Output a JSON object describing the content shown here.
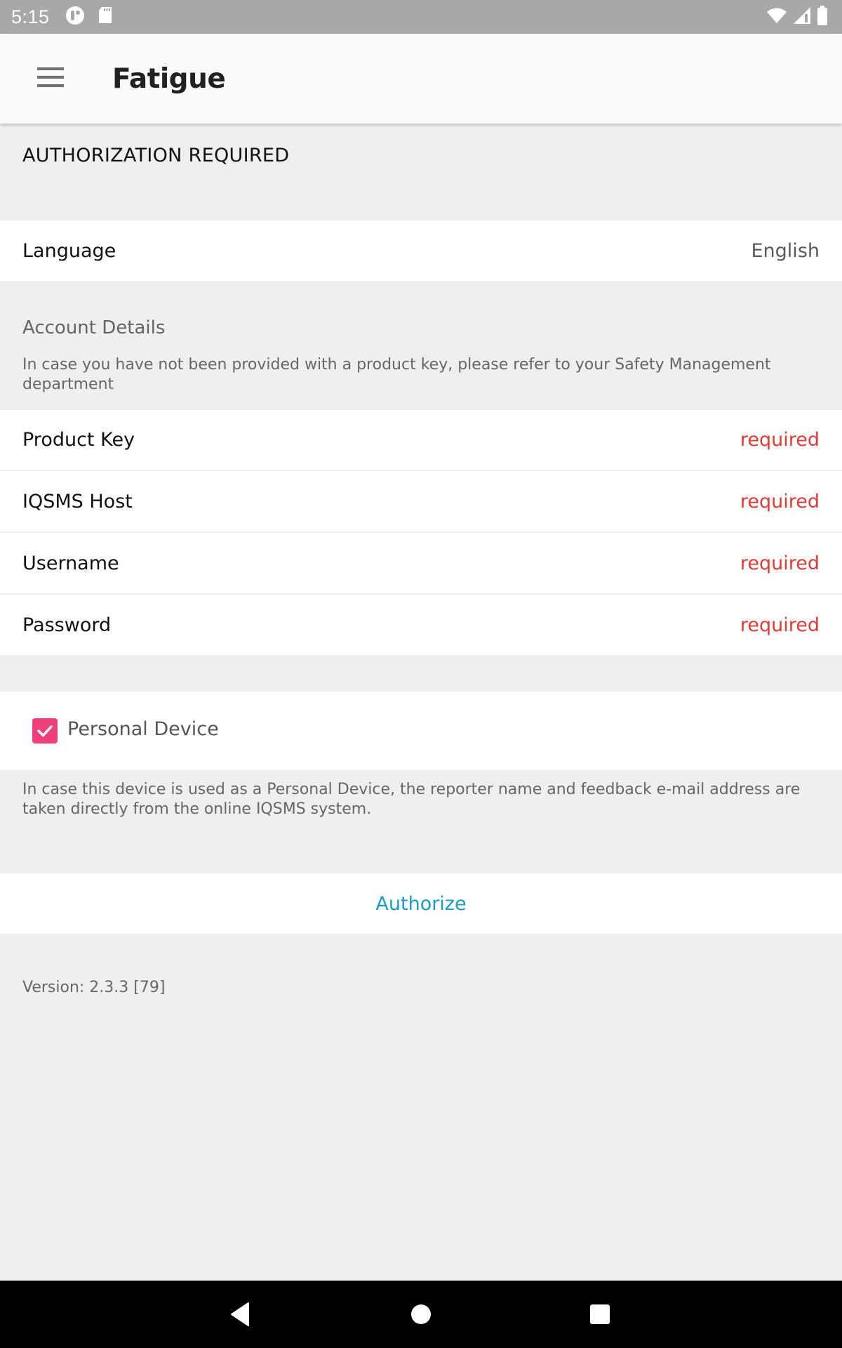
{
  "status_bar": {
    "time": "5:15",
    "left_icons": [
      "app-notification-icon",
      "sd-card-icon"
    ],
    "right_icons": [
      "wifi-icon",
      "cell-signal-icon",
      "battery-icon"
    ]
  },
  "app_bar": {
    "menu_icon": "hamburger-menu-icon",
    "title": "Fatigue"
  },
  "auth_section": {
    "title": "AUTHORIZATION REQUIRED"
  },
  "language": {
    "label": "Language",
    "value": "English"
  },
  "account_details": {
    "title": "Account Details",
    "description": "In case you have not been provided with a product key, please refer to your Safety Management department",
    "fields": [
      {
        "label": "Product Key",
        "value": "required"
      },
      {
        "label": "IQSMS Host",
        "value": "required"
      },
      {
        "label": "Username",
        "value": "required"
      },
      {
        "label": "Password",
        "value": "required"
      }
    ]
  },
  "personal_device": {
    "label": "Personal Device",
    "checked": true,
    "description": "In case this device is used as a Personal Device, the reporter name and feedback e-mail address are taken directly from the online IQSMS system."
  },
  "authorize": {
    "label": "Authorize"
  },
  "footer": {
    "version": "Version: 2.3.3 [79]"
  },
  "nav_bar": {
    "buttons": [
      "back-icon",
      "home-icon",
      "recents-icon"
    ]
  },
  "colors": {
    "required": "#e53935",
    "accent_link": "#1a9bc9",
    "checkbox": "#f13f79",
    "status_bar": "#a8a8a8",
    "background": "#efefef"
  }
}
